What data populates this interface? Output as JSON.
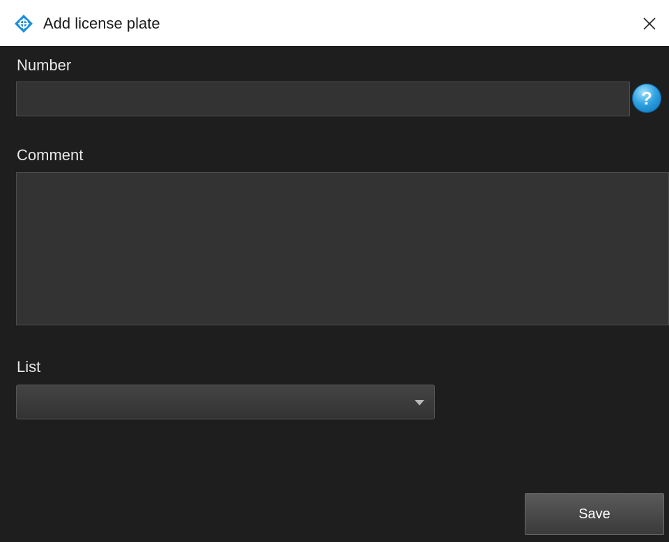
{
  "window": {
    "title": "Add license plate",
    "app_icon": "crosshair-diamond-icon",
    "close_icon": "close-icon"
  },
  "form": {
    "number": {
      "label": "Number",
      "value": "",
      "help_icon": "help-icon",
      "help_glyph": "?"
    },
    "comment": {
      "label": "Comment",
      "value": ""
    },
    "list": {
      "label": "List",
      "selected": "",
      "dropdown_icon": "chevron-down-icon"
    },
    "save_label": "Save"
  },
  "colors": {
    "background": "#1e1e1e",
    "field_background": "#333333",
    "accent": "#1e8fd9",
    "titlebar": "#ffffff"
  }
}
